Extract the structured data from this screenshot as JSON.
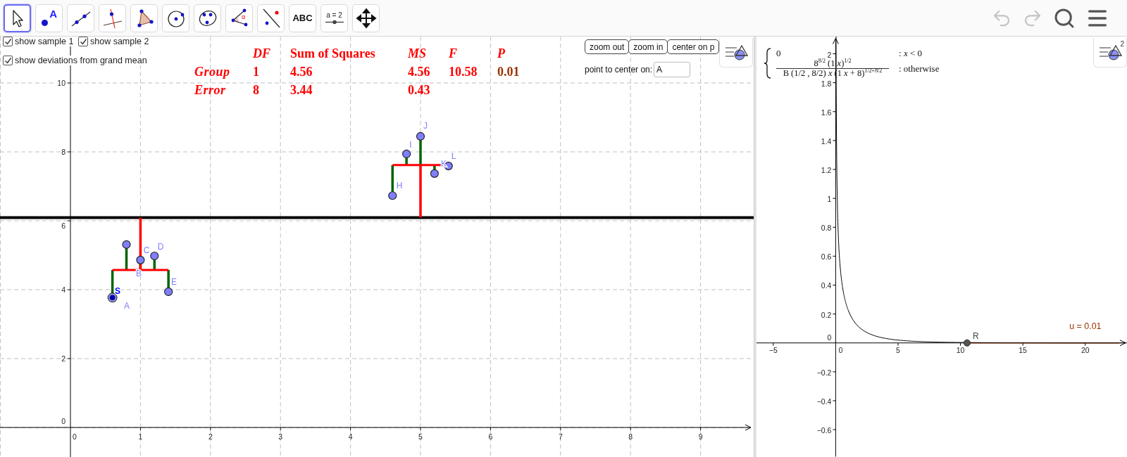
{
  "toolbar": {
    "tools": [
      {
        "kind": "move",
        "selected": true
      },
      {
        "kind": "point",
        "selected": false,
        "label": "A"
      },
      {
        "kind": "line",
        "selected": false
      },
      {
        "kind": "perpendicular",
        "selected": false
      },
      {
        "kind": "polygon",
        "selected": false
      },
      {
        "kind": "circle",
        "selected": false
      },
      {
        "kind": "conic",
        "selected": false
      },
      {
        "kind": "angle",
        "selected": false,
        "label": "α"
      },
      {
        "kind": "reflect",
        "selected": false
      },
      {
        "kind": "text",
        "selected": false,
        "label": "ABC"
      },
      {
        "kind": "slider",
        "selected": false,
        "label": "a = 2"
      },
      {
        "kind": "move-view",
        "selected": false
      }
    ],
    "actions": [
      {
        "kind": "undo",
        "disabled": true
      },
      {
        "kind": "redo",
        "disabled": true
      },
      {
        "kind": "search",
        "disabled": false
      },
      {
        "kind": "menu",
        "disabled": false
      }
    ]
  },
  "graphics_1": {
    "checkboxes": [
      {
        "label": "show sample 1",
        "checked": true
      },
      {
        "label": "show sample 2",
        "checked": true
      },
      {
        "label": "show deviations from grand mean",
        "checked": true
      }
    ],
    "anova": {
      "columns": [
        {
          "label": "DF",
          "italic": true
        },
        {
          "label": "Sum of Squares",
          "italic": false
        },
        {
          "label": "MS",
          "italic": true
        },
        {
          "label": "F",
          "italic": true
        },
        {
          "label": "P",
          "italic": true
        }
      ],
      "rows": [
        {
          "label": "Group",
          "cells": [
            {
              "text": "1",
              "color": "#ff0000"
            },
            {
              "text": "4.56",
              "color": "#ff0000"
            },
            {
              "text": "4.56",
              "color": "#ff0000"
            },
            {
              "text": "10.58",
              "color": "#ff0000"
            },
            {
              "text": "0.01",
              "color": "#993300"
            }
          ]
        },
        {
          "label": "Error",
          "cells": [
            {
              "text": "8",
              "color": "#ff0000"
            },
            {
              "text": "3.44",
              "color": "#ff0000"
            },
            {
              "text": "0.43",
              "color": "#ff0000"
            }
          ]
        }
      ]
    },
    "buttons": [
      "zoom out",
      "zoom in",
      "center on p"
    ],
    "center_field": {
      "label": "point to center on:",
      "value": "A"
    },
    "y_ticks": [
      "10",
      "8",
      "6",
      "4",
      "2",
      "0"
    ],
    "x_ticks": [
      "0",
      "1",
      "2",
      "3",
      "4",
      "5",
      "6",
      "7",
      "8",
      "9"
    ],
    "point_labels": [
      "S",
      "A",
      "B",
      "C",
      "D",
      "E",
      "H",
      "I",
      "J",
      "K",
      "L"
    ]
  },
  "graphics_2": {
    "formula": [
      {
        "kind": "plain",
        "value": "0",
        "condition": ": *x* < 0"
      },
      {
        "kind": "fraction",
        "numerator": "8$^{8/2}$ (1 *x*)$^{1/2}$",
        "denominator": "B (1/2 , 8/2) *x* (1 *x* + 8)$^{1/2+8/2}$",
        "condition": ": otherwise"
      }
    ],
    "x_ticks": [
      "−5",
      "0",
      "5",
      "10",
      "15",
      "20"
    ],
    "y_ticks": [
      "2",
      "1.8",
      "1.6",
      "1.4",
      "1.2",
      "1",
      "0.8",
      "0.6",
      "0.4",
      "0.2",
      "0",
      "−0.2",
      "−0.4",
      "−0.6"
    ],
    "point_label": "R",
    "readout": "u = 0.01",
    "style_badge": "2"
  }
}
